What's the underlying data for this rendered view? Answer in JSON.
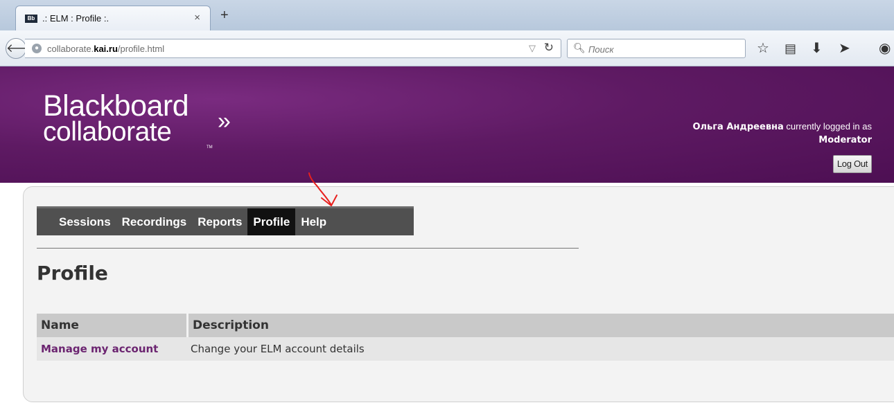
{
  "browser": {
    "tab_title": ".: ELM : Profile :.",
    "favicon_text": "Bb",
    "tab_close": "×",
    "new_tab": "+",
    "url_prefix": "collaborate.",
    "url_domain": "kai.ru",
    "url_path": "/profile.html",
    "search_placeholder": "Поиск"
  },
  "header": {
    "logo_line1": "Blackboard",
    "logo_line2": "collaborate",
    "logo_chevron": "»",
    "logo_tm": "TM",
    "user_name": "Ольга Андреевна",
    "logged_text": " currently logged in as",
    "role": "Moderator",
    "logout_label": "Log Out"
  },
  "nav": {
    "items": [
      {
        "label": "Sessions",
        "active": false
      },
      {
        "label": "Recordings",
        "active": false
      },
      {
        "label": "Reports",
        "active": false
      },
      {
        "label": "Profile",
        "active": true
      },
      {
        "label": "Help",
        "active": false
      }
    ]
  },
  "page": {
    "title": "Profile"
  },
  "table": {
    "headers": [
      "Name",
      "Description"
    ],
    "rows": [
      {
        "name": "Manage my account",
        "description": "Change your ELM account details"
      }
    ]
  },
  "colors": {
    "header_purple": "#5e1a63",
    "link_purple": "#6b2470",
    "menu_bg": "#505050",
    "annotation_red": "#e8201e"
  }
}
